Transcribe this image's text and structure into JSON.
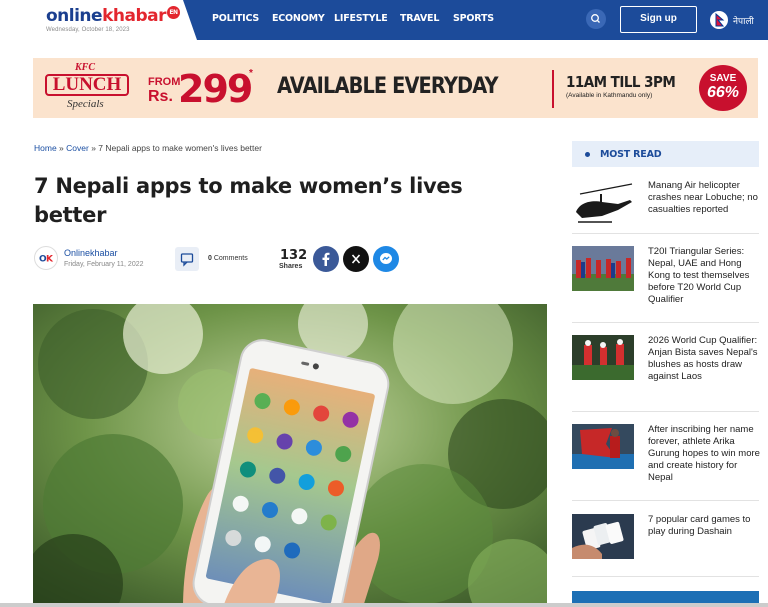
{
  "header": {
    "logo_part1": "online",
    "logo_part2": "khabar",
    "logo_badge": "EN",
    "date": "Wednesday, October 18, 2023",
    "nav": [
      "POLITICS",
      "ECONOMY",
      "LIFESTYLE",
      "TRAVEL",
      "SPORTS"
    ],
    "signup_label": "Sign up",
    "lang_label": "नेपाली"
  },
  "ad": {
    "brand": "KFC",
    "lunch": "LUNCH",
    "specials": "Specials",
    "from": "FROM",
    "currency": "Rs.",
    "price": "299",
    "star": "*",
    "available": "AVAILABLE EVERYDAY",
    "time": "11AM TILL 3PM",
    "note": "(Available in Kathmandu only)",
    "save_label": "SAVE",
    "save_value": "66%"
  },
  "breadcrumb": {
    "home": "Home",
    "sep1": " » ",
    "cover": "Cover",
    "sep2": " » ",
    "current": "7 Nepali apps to make women's lives better"
  },
  "article": {
    "title": "7 Nepali apps to make women’s lives better",
    "author": "Onlinekhabar",
    "date": "Friday, February 11, 2022",
    "comment_count": "0",
    "comment_label": "Comments",
    "share_count": "132",
    "share_label": "Shares"
  },
  "sidebar": {
    "heading": "MOST READ",
    "items": [
      {
        "title": "Manang Air helicopter crashes near Lobuche; no casualties reported"
      },
      {
        "title": "T20I Triangular Series: Nepal, UAE and Hong Kong to test themselves before T20 World Cup Qualifier"
      },
      {
        "title": "2026 World Cup Qualifier: Anjan Bista saves Nepal's blushes as hosts draw against Laos"
      },
      {
        "title": "After inscribing her name forever, athlete Arika Gurung hopes to win more and create history for Nepal"
      },
      {
        "title": "7 popular card games to play during Dashain"
      }
    ]
  },
  "colors": {
    "brand_blue": "#1c4b9a",
    "brand_red": "#e3262e",
    "ad_red": "#c8102e",
    "facebook": "#3b5998",
    "x": "#111111",
    "messenger": "#1e88e5"
  }
}
